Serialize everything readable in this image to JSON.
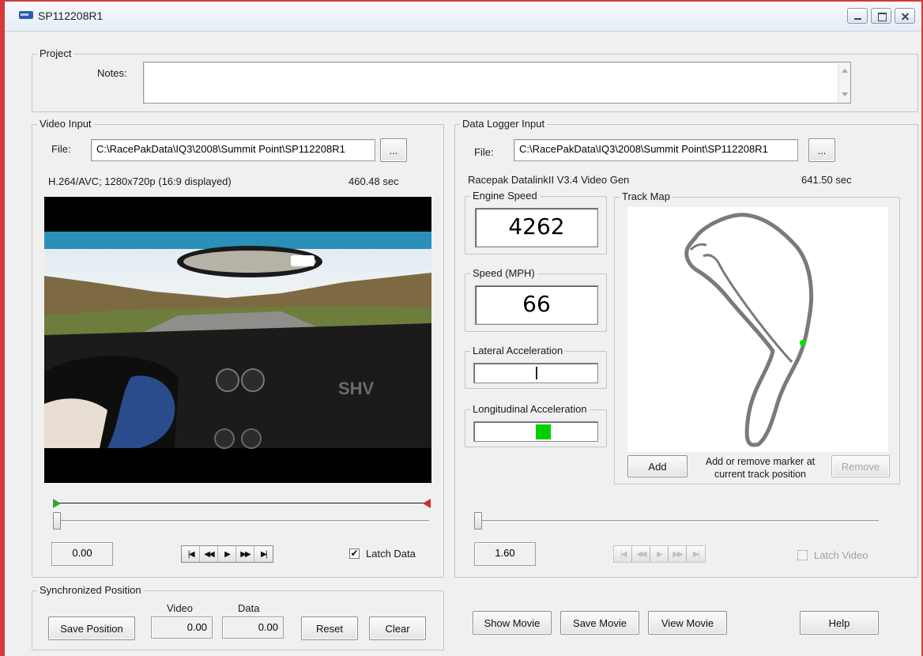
{
  "window": {
    "title": "SP112208R1"
  },
  "project": {
    "legend": "Project",
    "notes_label": "Notes:",
    "notes_value": ""
  },
  "video_input": {
    "legend": "Video Input",
    "file_label": "File:",
    "file_path": "C:\\RacePakData\\IQ3\\2008\\Summit Point\\SP112208R1",
    "browse_label": "...",
    "codec_info": "H.264/AVC; 1280x720p (16:9 displayed)",
    "duration": "460.48 sec",
    "position_value": "0.00",
    "latch_label": "Latch Data",
    "latch_checked": true
  },
  "data_logger": {
    "legend": "Data Logger Input",
    "file_label": "File:",
    "file_path": "C:\\RacePakData\\IQ3\\2008\\Summit Point\\SP112208R1",
    "browse_label": "...",
    "source_info": "Racepak DatalinkII V3.4 Video Gen",
    "duration": "641.50 sec",
    "engine_speed_label": "Engine Speed",
    "engine_speed_value": "4262",
    "speed_label": "Speed (MPH)",
    "speed_value": "66",
    "lateral_label": "Lateral Acceleration",
    "longitudinal_label": "Longitudinal Acceleration",
    "position_value": "1.60",
    "latch_label": "Latch Video",
    "latch_checked": false
  },
  "track_map": {
    "legend": "Track Map",
    "add_label": "Add",
    "hint": "Add or remove marker at current track position",
    "remove_label": "Remove",
    "marker_color": "#00e000"
  },
  "sync": {
    "legend": "Synchronized Position",
    "save_label": "Save Position",
    "video_label": "Video",
    "data_label": "Data",
    "video_value": "0.00",
    "data_value": "0.00",
    "reset_label": "Reset",
    "clear_label": "Clear"
  },
  "bottom_buttons": {
    "show_movie": "Show Movie",
    "save_movie": "Save Movie",
    "view_movie": "View Movie",
    "help": "Help"
  },
  "transport_icons": [
    "first-frame-icon",
    "rewind-icon",
    "play-icon",
    "fast-forward-icon",
    "last-frame-icon"
  ],
  "colors": {
    "accent_green": "#00d000",
    "start_marker": "#2fa83a",
    "end_marker": "#d02a2a"
  }
}
